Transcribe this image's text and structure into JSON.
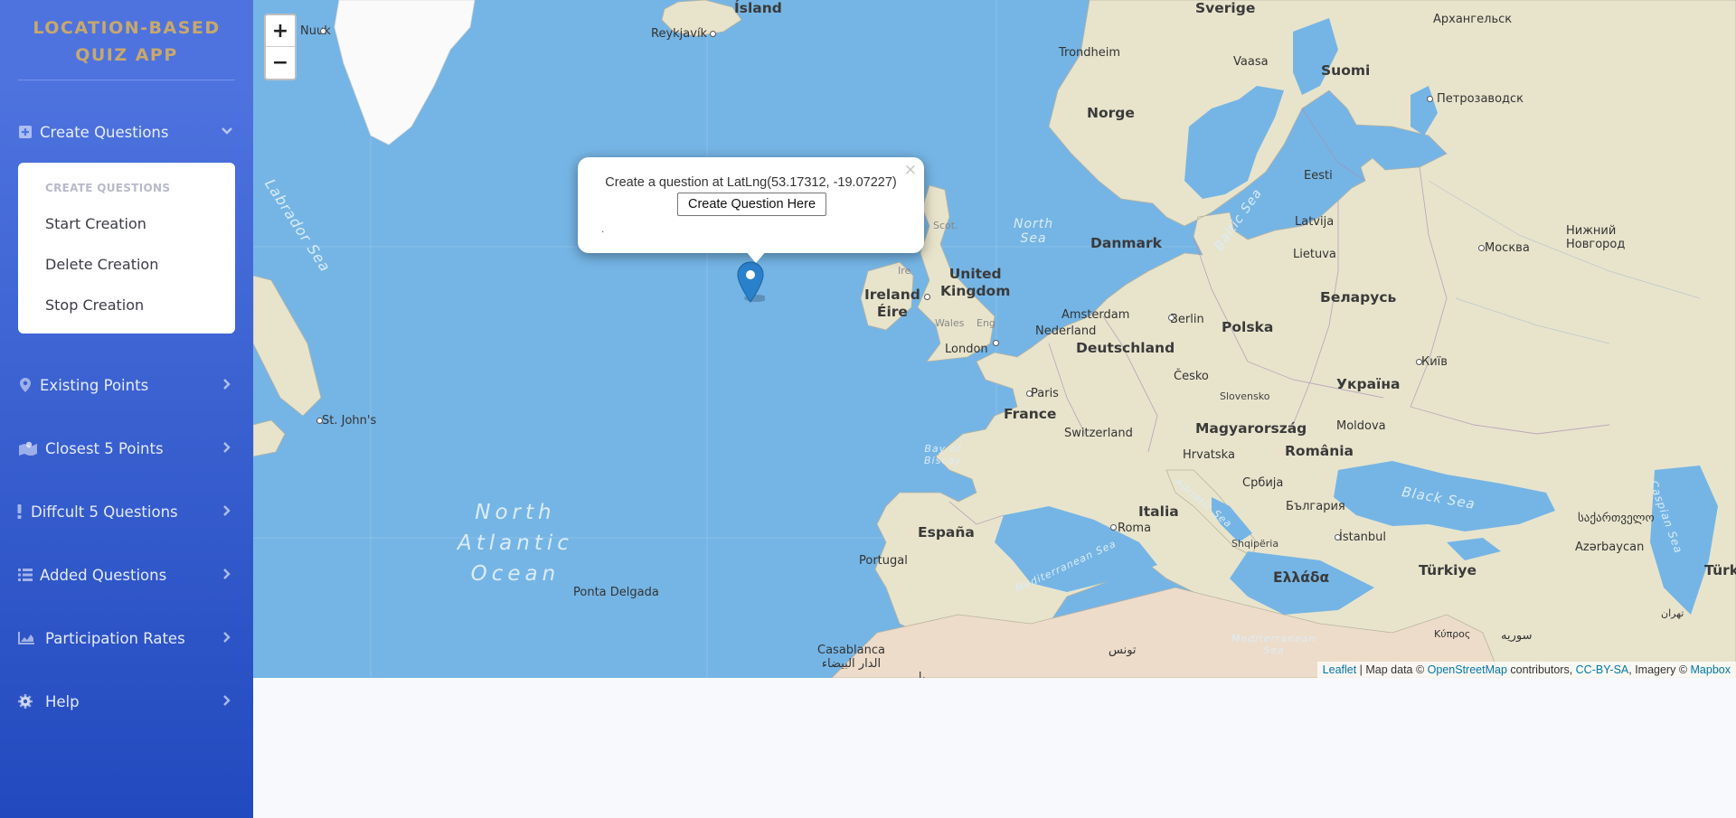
{
  "brand": {
    "line1": "LOCATION-BASED",
    "line2": "QUIZ APP"
  },
  "colors": {
    "sidebar_top": "#4e73df",
    "sidebar_bottom": "#224abe",
    "brand_text": "#c9a86a",
    "water": "#75b5e5",
    "land": "#e8e4cc"
  },
  "sidebar": {
    "create": {
      "label": "Create Questions",
      "icon": "plus-square-icon",
      "expanded": true,
      "submenu_header": "CREATE QUESTIONS",
      "items": [
        "Start Creation",
        "Delete Creation",
        "Stop Creation"
      ]
    },
    "items": [
      {
        "label": "Existing Points",
        "icon": "map-marker-icon"
      },
      {
        "label": "Closest 5 Points",
        "icon": "map-icon"
      },
      {
        "label": "Diffcult 5 Questions",
        "icon": "exclamation-icon"
      },
      {
        "label": "Added Questions",
        "icon": "list-icon"
      },
      {
        "label": "Participation Rates",
        "icon": "area-chart-icon"
      },
      {
        "label": "Help",
        "icon": "cog-icon"
      }
    ]
  },
  "map": {
    "zoom_in": "+",
    "zoom_out": "−",
    "popup": {
      "text": "Create a question at LatLng(53.17312, -19.07227)",
      "button": "Create Question Here",
      "close": "×",
      "footer": "."
    },
    "attribution": {
      "leaflet": "Leaflet",
      "sep": " | Map data © ",
      "osm": "OpenStreetMap",
      "mid": " contributors, ",
      "license": "CC-BY-SA",
      "imagery": ", Imagery © ",
      "mapbox": "Mapbox"
    },
    "labels": {
      "island": "Ísland",
      "reykjavik": "Reykjavík",
      "nuuk": "Nuuk",
      "labrador_sea": "Labrador Sea",
      "st_johns": "St. John's",
      "north_atlantic": "North",
      "north_atlantic2": "Atlantic",
      "north_atlantic3": "Ocean",
      "ponta_delgada": "Ponta Delgada",
      "sverige": "Sverige",
      "norge": "Norge",
      "suomi": "Suomi",
      "trondheim": "Trondheim",
      "vaasa": "Vaasa",
      "arkhangelsk": "Архангельск",
      "petrozavodsk": "Петрозаводск",
      "eesti": "Eesti",
      "latvija": "Latvija",
      "lietuva": "Lietuva",
      "moskva": "Москва",
      "nizhny1": "Нижний",
      "nizhny2": "Новгород",
      "belarus": "Беларусь",
      "ukraina": "Україна",
      "kyiv": "Київ",
      "danmark": "Danmark",
      "north_sea1": "North",
      "north_sea2": "Sea",
      "baltic_sea": "Baltic Sea",
      "scot": "Scot.",
      "ire": "Ire",
      "uk1": "United",
      "uk2": "Kingdom",
      "ireland": "Ireland",
      "eire": "Éire",
      "wales": "Wales",
      "eng": "Eng",
      "london": "London",
      "amsterdam": "Amsterdam",
      "nederland": "Nederland",
      "berlin": "Berlin",
      "polska": "Polska",
      "deutschland": "Deutschland",
      "cesko": "Česko",
      "slovensko": "Slovensko",
      "paris": "Paris",
      "france": "France",
      "switzerland": "Switzerland",
      "magyarorszag": "Magyarország",
      "moldova": "Moldova",
      "romania": "România",
      "hrvatska": "Hrvatska",
      "srbija": "Србија",
      "italia": "Italia",
      "roma": "Roma",
      "adriatic": "Adriatic Sea",
      "bulgaria": "България",
      "shqiperia": "Shqipëria",
      "bay1": "Bay of",
      "bay2": "Biscay",
      "espana": "España",
      "portugal": "Portugal",
      "mediterranean": "Mediterranean Sea",
      "black_sea": "Black Sea",
      "istanbul": "İstanbul",
      "turkiye": "Türkiye",
      "ellada": "Ελλάδα",
      "georgia": "საქართველო",
      "azarbaycan": "Azərbaycan",
      "caspian": "Caspian Sea",
      "turk": "Türk",
      "casablanca1": "Casablanca",
      "casablanca2": "الدار البيضاء",
      "tunis": "تونس",
      "kibris": "Κύπρος",
      "suriya": "سوريه",
      "tehran": "تهران",
      "med2a": "Mediterranean",
      "med2b": "Sea",
      "bel": "بل"
    }
  }
}
